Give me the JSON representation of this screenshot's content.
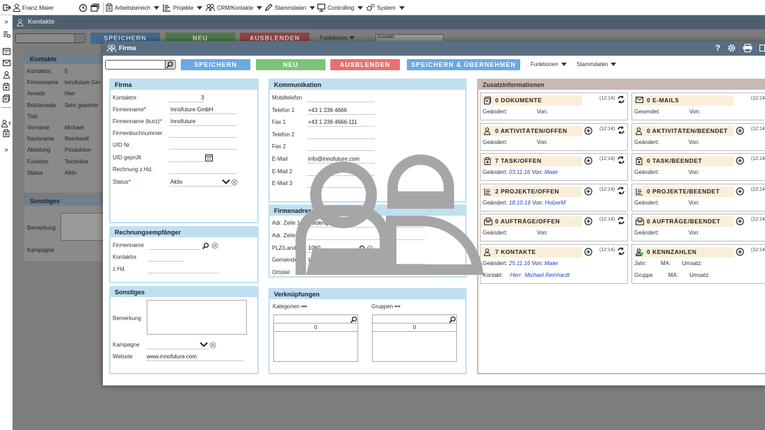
{
  "topnav": {
    "user": "Franz Maier",
    "items": [
      "Arbeitsbereich",
      "Projekte",
      "CRM/Kontakte",
      "Stammdaten",
      "Controlling",
      "System"
    ]
  },
  "background": {
    "title": "Kontakte",
    "buttons": [
      "SPEICHERN",
      "NEU",
      "AUSBLENDEN"
    ],
    "funktionen": "Funktionen",
    "select": "Kontakt",
    "panel_title": "Kontakte",
    "rows": [
      {
        "label": "Kontaktnr.",
        "value": "5"
      },
      {
        "label": "Firmenname",
        "value": "Innofuture Gm"
      },
      {
        "label": "Anrede",
        "value": "Herr"
      },
      {
        "label": "Briefanrede",
        "value": "Sehr geehrter"
      },
      {
        "label": "Titel",
        "value": ""
      },
      {
        "label": "Vorname",
        "value": "Michael"
      },
      {
        "label": "Nachname",
        "value": "Reinhardt"
      },
      {
        "label": "Abteilung",
        "value": "Produktion"
      },
      {
        "label": "Funktion",
        "value": "Techniker"
      },
      {
        "label": "Status",
        "value": "Aktiv"
      }
    ],
    "panel2_title": "Sonstiges",
    "panel2_rows": [
      "Bemerkung",
      "Kampagne"
    ]
  },
  "dialog": {
    "title": "Firma",
    "buttons": {
      "save": "SPEICHERN",
      "new": "NEU",
      "hide": "AUSBLENDEN",
      "save_apply": "SPEICHERN & ÜBERNEHMEN"
    },
    "menus": {
      "funktionen": "Funktionen",
      "stammdaten": "Stammdaten"
    },
    "colors": {
      "save": "#6aa9e3",
      "new": "#7cc47a",
      "hide": "#e8706e",
      "save_apply": "#6aa9e3"
    }
  },
  "firma": {
    "title": "Firma",
    "fields": [
      {
        "label": "Kontaktnr.",
        "value": "3",
        "required": false
      },
      {
        "label": "Firmenname",
        "value": "Innofuture GmbH",
        "required": true
      },
      {
        "label": "Firmenname (kurz)",
        "value": "Innofuture",
        "required": true
      },
      {
        "label": "Firmenbuchnummer",
        "value": "",
        "required": false
      },
      {
        "label": "UID Nr.",
        "value": "",
        "required": false
      },
      {
        "label": "UID geprüft",
        "value": "",
        "required": false
      },
      {
        "label": "Rechnung z.Hd.",
        "value": "",
        "required": false
      },
      {
        "label": "Status",
        "value": "Aktiv",
        "required": true
      }
    ]
  },
  "rechnung": {
    "title": "Rechnungsempfänger",
    "fields": [
      "Firmenname",
      "Kontaktnr.",
      "z.Hd."
    ]
  },
  "sonstiges": {
    "title": "Sonstiges",
    "bemerkung": "Bemerkung",
    "kampagne": "Kampagne",
    "website_label": "Website",
    "website": "www.innofuture.com"
  },
  "kommunikation": {
    "title": "Kommunikation",
    "fields": [
      {
        "label": "Mobiltelefon",
        "value": ""
      },
      {
        "label": "Telefon 1",
        "value": "+43 1 236 4666"
      },
      {
        "label": "Fax 1",
        "value": "+43 1 236 4666-111"
      },
      {
        "label": "Telefon 2",
        "value": ""
      },
      {
        "label": "Fax 2",
        "value": ""
      },
      {
        "label": "E-Mail",
        "value": "info@innofuture.com"
      },
      {
        "label": "E-Mail 2",
        "value": ""
      },
      {
        "label": "E-Mail 3",
        "value": ""
      }
    ]
  },
  "adresse": {
    "title": "Firmenadresse",
    "fields": [
      {
        "label": "Adr. Zeile 1",
        "value": "Seidengasse"
      },
      {
        "label": "Adr. Zeile 2",
        "value": ""
      },
      {
        "label": "PLZ/Land",
        "value": "1060"
      },
      {
        "label": "Gemeinde",
        "value": "Wien"
      },
      {
        "label": "Ortsteil",
        "value": "Wien 6. Bezirk (Mariahilf"
      }
    ]
  },
  "verknuepfungen": {
    "title": "Verknüpfungen",
    "kategorien": "Kategorien",
    "gruppen": "Gruppen",
    "kat_count": "0",
    "grp_count": "0"
  },
  "zusatz": {
    "title": "Zusatzinformationen",
    "cards": [
      {
        "title": "0 DOKUMENTE",
        "time": "(12:14)",
        "row": "Geändert:",
        "von": "Von:",
        "date": "",
        "user": "",
        "icon": "document-icon",
        "add": false,
        "refresh": true
      },
      {
        "title": "0 E-MAILS",
        "time": "(12:14",
        "row": "Gesendet:",
        "von": "Von:",
        "date": "",
        "user": "",
        "icon": "mail-icon",
        "add": false,
        "refresh": false
      },
      {
        "title": "0 AKTIVITÄTEN/OFFEN",
        "time": "(12:14)",
        "row": "Geändert:",
        "von": "Von:",
        "date": "",
        "user": "",
        "icon": "person-icon",
        "add": true,
        "refresh": true
      },
      {
        "title": "0 AKTIVITÄTEN/BEENDET",
        "time": "(12:14",
        "row": "Geändert:",
        "von": "Von:",
        "date": "",
        "user": "",
        "icon": "person-icon",
        "add": true,
        "refresh": false
      },
      {
        "title": "7 TASK/OFFEN",
        "time": "(12:14)",
        "row": "Geändert:",
        "von": "Von:",
        "date": "03.11.16",
        "user": "Maier",
        "icon": "task-icon",
        "add": true,
        "refresh": true
      },
      {
        "title": "0 TASK/BEENDET",
        "time": "(12:14",
        "row": "Geändert:",
        "von": "Von:",
        "date": "",
        "user": "",
        "icon": "task-icon",
        "add": true,
        "refresh": false
      },
      {
        "title": "2 PROJEKTE/OFFEN",
        "time": "(12:14)",
        "row": "Geändert:",
        "von": "Von:",
        "date": "18.10.16",
        "user": "HolzerM",
        "icon": "project-icon",
        "add": true,
        "refresh": true
      },
      {
        "title": "0 PROJEKTE/BEENDET",
        "time": "(12:14",
        "row": "Geändert:",
        "von": "Von:",
        "date": "",
        "user": "",
        "icon": "project-icon",
        "add": true,
        "refresh": false
      },
      {
        "title": "0 AUFTRÄGE/OFFEN",
        "time": "(12:14)",
        "row": "Geändert:",
        "von": "Von:",
        "date": "",
        "user": "",
        "icon": "order-icon",
        "add": true,
        "refresh": true
      },
      {
        "title": "0 AUFTRÄGE/BEENDET",
        "time": "(12:14",
        "row": "Geändert:",
        "von": "Von:",
        "date": "",
        "user": "",
        "icon": "order-icon",
        "add": true,
        "refresh": false
      },
      {
        "title": "7 KONTAKTE",
        "time": "(12:14)",
        "row": "Geändert:",
        "von": "Von:",
        "date": "25.11.16",
        "user": "Maier",
        "icon": "contacts-icon",
        "add": true,
        "refresh": true,
        "row2_label": "Kontakt:",
        "row2_a": "Herr",
        "row2_b": "Michael Reinhardt"
      },
      {
        "title": "0 KENNZAHLEN",
        "time": "(12:14",
        "row": "Jahr:",
        "von": "MA:",
        "date": "",
        "user": "Umsatz:",
        "icon": "kpi-icon",
        "add": true,
        "refresh": false,
        "row2_label": "Gruppe",
        "row2_a": "MA:",
        "row2_b": "Umsatz:"
      }
    ]
  }
}
